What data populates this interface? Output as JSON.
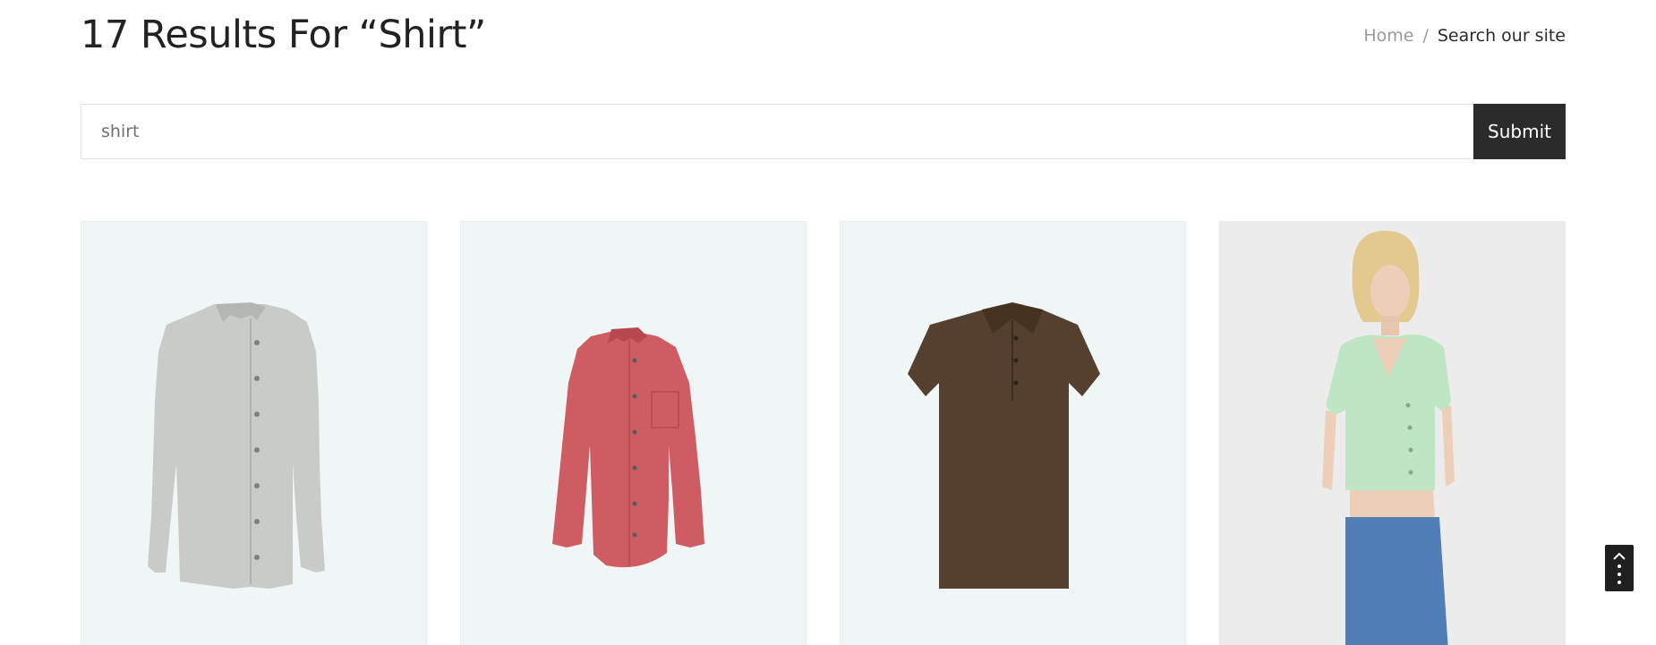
{
  "header": {
    "title": "17 Results For “Shirt”",
    "breadcrumb": {
      "home": "Home",
      "separator": "/",
      "current": "Search our site"
    }
  },
  "search": {
    "value": "shirt",
    "submit_label": "Submit"
  },
  "products": [
    {
      "image": "grey-long-sleeve-shirt",
      "color": "#c9cbc8"
    },
    {
      "image": "red-long-sleeve-shirt",
      "color": "#cf5b63"
    },
    {
      "image": "brown-polo-shirt",
      "color": "#55402f"
    },
    {
      "image": "model-green-crop-cardigan",
      "color": "#bfe6c4"
    }
  ],
  "scroll_button": {
    "icon": "chevron-up-icon"
  }
}
